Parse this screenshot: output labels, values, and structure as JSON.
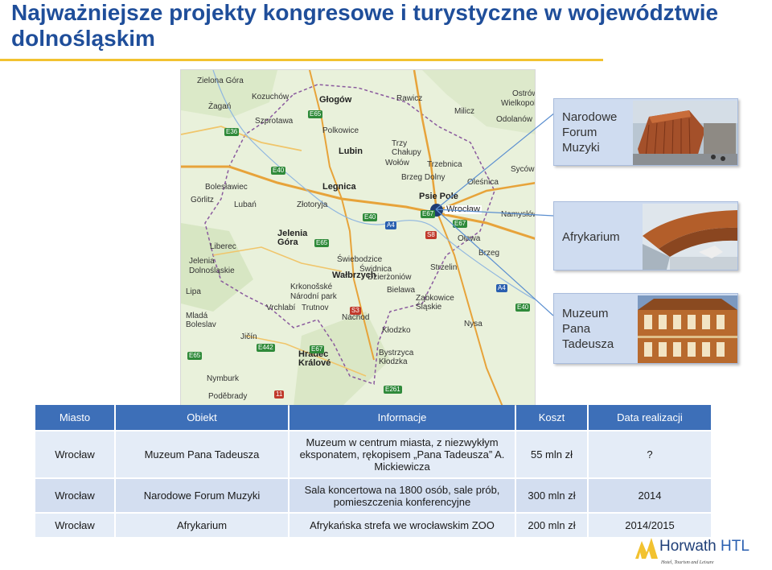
{
  "title": {
    "line1": "Najważniejsze projekty kongresowe i turystyczne w województwie",
    "line2": "dolnośląskim"
  },
  "map": {
    "cities": [
      {
        "name": "Zielona Góra",
        "label": "Zielona Góra"
      },
      {
        "name": "Kozuchów",
        "label": "Kozuchów"
      },
      {
        "name": "Głogów",
        "label": "Głogów"
      },
      {
        "name": "Rawicz",
        "label": "Rawicz"
      },
      {
        "name": "Ostrów",
        "label": "Ostrów"
      },
      {
        "name": "Wielkopolski",
        "label": "Wielkopolski"
      },
      {
        "name": "Żagań",
        "label": "Żagań"
      },
      {
        "name": "Szprotawa",
        "label": "Szprotawa"
      },
      {
        "name": "Polkowice",
        "label": "Polkowice"
      },
      {
        "name": "Milicz",
        "label": "Milicz"
      },
      {
        "name": "Odolanów",
        "label": "Odolanów"
      },
      {
        "name": "Lubin",
        "label": "Lubin"
      },
      {
        "name": "Trzy Chałupy",
        "label": "Trzy\nChałupy"
      },
      {
        "name": "Wołów",
        "label": "Wołów"
      },
      {
        "name": "Trzebnica",
        "label": "Trzebnica"
      },
      {
        "name": "Syców",
        "label": "Syców"
      },
      {
        "name": "Brzeg Dolny",
        "label": "Brzeg Dolny"
      },
      {
        "name": "Bolesławiec",
        "label": "Bolesławiec"
      },
      {
        "name": "Legnica",
        "label": "Legnica"
      },
      {
        "name": "Psie Pole",
        "label": "Psie Pole"
      },
      {
        "name": "Oleśnica",
        "label": "Oleśnica"
      },
      {
        "name": "Görlitz",
        "label": "Görlitz"
      },
      {
        "name": "Złotoryja",
        "label": "Złotoryja"
      },
      {
        "name": "Wrocław",
        "label": "Wrocław"
      },
      {
        "name": "Namysłów",
        "label": "Namysłów"
      },
      {
        "name": "Lubań",
        "label": "Lubań"
      },
      {
        "name": "Jelenia Góra",
        "label": "Jelenia\nGóra"
      },
      {
        "name": "Oława",
        "label": "Oława"
      },
      {
        "name": "Świebodzice",
        "label": "Świebodzice"
      },
      {
        "name": "Brzeg",
        "label": "Brzeg"
      },
      {
        "name": "Liberec",
        "label": "Liberec"
      },
      {
        "name": "Jelenia",
        "label": "Jelenia"
      },
      {
        "name": "Strzelin",
        "label": "Strzelin"
      },
      {
        "name": "Dolnośląskie",
        "label": "Dolnośląskie"
      },
      {
        "name": "Wałbrzych",
        "label": "Wałbrzych"
      },
      {
        "name": "Dzierżoniów",
        "label": "Dzierżoniów"
      },
      {
        "name": "Bielawa",
        "label": "Bielawa"
      },
      {
        "name": "Lipa",
        "label": "Lipa"
      },
      {
        "name": "Krkonošské",
        "label": "Krkonošské"
      },
      {
        "name": "Národní park",
        "label": "Národní park"
      },
      {
        "name": "Ząbkowice Śląskie",
        "label": "Ząbkowice\nŚląskie"
      },
      {
        "name": "Vrchlabí",
        "label": "Vrchlabí"
      },
      {
        "name": "Trutnov",
        "label": "Trutnov"
      },
      {
        "name": "Nysa",
        "label": "Nysa"
      },
      {
        "name": "Mladá Boleslav",
        "label": "Mladá\nBoleslav"
      },
      {
        "name": "Náchod",
        "label": "Náchod"
      },
      {
        "name": "Kłodzko",
        "label": "Kłodzko"
      },
      {
        "name": "Jičín",
        "label": "Jičín"
      },
      {
        "name": "Hradec Králové",
        "label": "Hradec\nKrálové"
      },
      {
        "name": "Bystrzyca Kłodzka",
        "label": "Bystrzyca\nKłodzka"
      },
      {
        "name": "Nymburk",
        "label": "Nymburk"
      },
      {
        "name": "Poděbrady",
        "label": "Poděbrady"
      },
      {
        "name": "Świdnica",
        "label": "Świdnica"
      }
    ],
    "roads": [
      "E36",
      "E40",
      "E65",
      "E65",
      "E40",
      "E67",
      "A4",
      "S8",
      "E67",
      "A4",
      "E40",
      "E442",
      "E67",
      "E65",
      "11",
      "S3",
      "E261"
    ]
  },
  "cards": [
    {
      "label": "Narodowe\nForum\nMuzyki"
    },
    {
      "label": "Afrykarium"
    },
    {
      "label": "Muzeum\nPana\nTadeusza"
    }
  ],
  "table": {
    "headers": [
      "Miasto",
      "Obiekt",
      "Informacje",
      "Koszt",
      "Data realizacji"
    ],
    "rows": [
      {
        "city": "Wrocław",
        "object": "Muzeum Pana Tadeusza",
        "info": "Muzeum w centrum miasta, z niezwykłym eksponatem, rękopisem „Pana Tadeusza” A. Mickiewicza",
        "cost": "55 mln zł",
        "date": "?"
      },
      {
        "city": "Wrocław",
        "object": "Narodowe Forum Muzyki",
        "info": "Sala koncertowa na 1800 osób, sale prób, pomieszczenia konferencyjne",
        "cost": "300 mln zł",
        "date": "2014"
      },
      {
        "city": "Wrocław",
        "object": "Afrykarium",
        "info": "Afrykańska strefa we wrocławskim ZOO",
        "cost": "200 mln zł",
        "date": "2014/2015"
      }
    ]
  },
  "logo": {
    "name_main": "Horwath",
    "name_suffix": " HTL",
    "tagline": "Hotel, Tourism and Leisure"
  },
  "colors": {
    "title": "#1f4e9a",
    "rule": "#f2c230",
    "header": "#3d6fb8",
    "row_light": "#e4ecf7",
    "row_dark": "#d3def0"
  }
}
